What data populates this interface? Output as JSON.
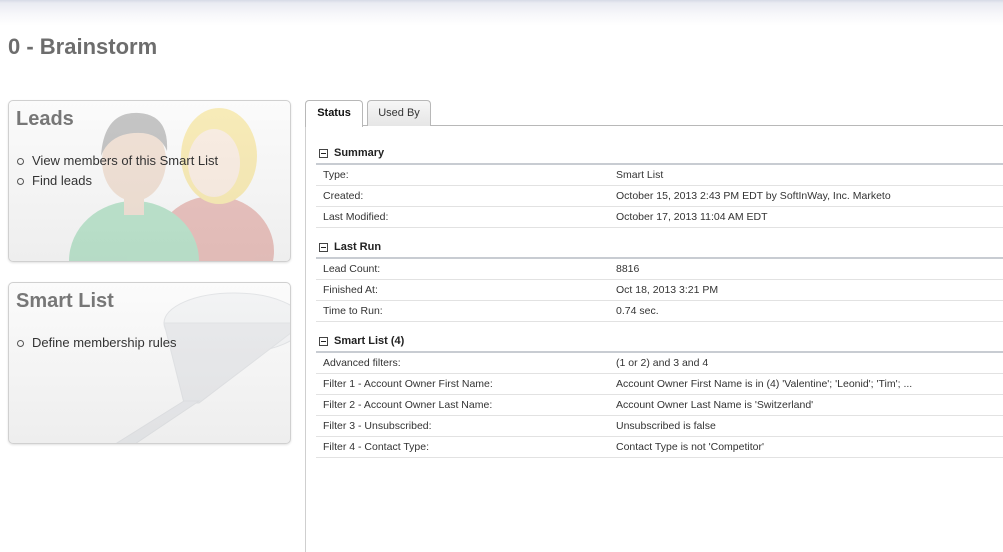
{
  "page": {
    "title": "0 - Brainstorm"
  },
  "leads_card": {
    "title": "Leads",
    "links": [
      "View members of this Smart List",
      "Find leads"
    ]
  },
  "smart_list_card": {
    "title": "Smart List",
    "links": [
      "Define membership rules"
    ]
  },
  "tabs": [
    {
      "label": "Status",
      "active": true
    },
    {
      "label": "Used By",
      "active": false
    }
  ],
  "summary": {
    "header": "Summary",
    "rows": [
      {
        "label": "Type:",
        "value": "Smart List"
      },
      {
        "label": "Created:",
        "value": "October 15, 2013 2:43 PM EDT by SoftInWay, Inc. Marketo"
      },
      {
        "label": "Last Modified:",
        "value": "October 17, 2013 11:04 AM EDT"
      }
    ]
  },
  "last_run": {
    "header": "Last Run",
    "rows": [
      {
        "label": "Lead Count:",
        "value": "8816"
      },
      {
        "label": "Finished At:",
        "value": "Oct 18, 2013 3:21 PM"
      },
      {
        "label": "Time to Run:",
        "value": "0.74 sec."
      }
    ]
  },
  "smart_list": {
    "header": "Smart List (4)",
    "rows": [
      {
        "label": "Advanced filters:",
        "value": "(1 or 2) and 3 and 4"
      },
      {
        "label": "Filter 1 - Account Owner First Name:",
        "value": "Account Owner First Name is in (4) 'Valentine'; 'Leonid'; 'Tim'; ..."
      },
      {
        "label": "Filter 2 - Account Owner Last Name:",
        "value": "Account Owner Last Name is 'Switzerland'"
      },
      {
        "label": "Filter 3 - Unsubscribed:",
        "value": "Unsubscribed is false"
      },
      {
        "label": "Filter 4 - Contact Type:",
        "value": "Contact Type is not 'Competitor'"
      }
    ]
  }
}
